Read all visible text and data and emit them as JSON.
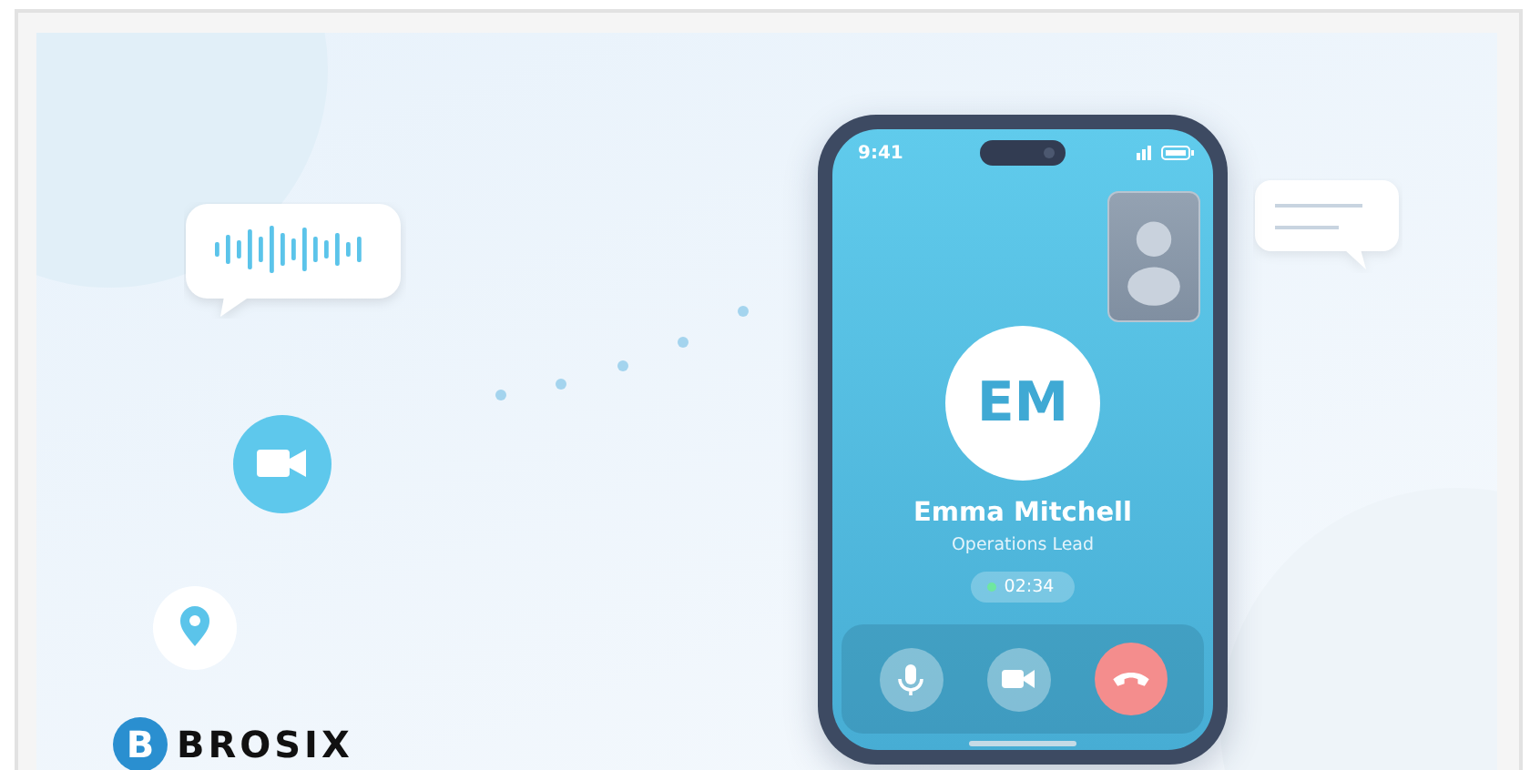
{
  "logo": {
    "mark": "B",
    "name": "BROSIX"
  },
  "phone": {
    "status_time": "9:41",
    "call": {
      "initials": "EM",
      "name": "Emma Mitchell",
      "role": "Operations Lead",
      "timer": "02:34",
      "live": true
    },
    "controls": [
      {
        "kind": "mic"
      },
      {
        "kind": "video"
      },
      {
        "kind": "end"
      }
    ]
  }
}
